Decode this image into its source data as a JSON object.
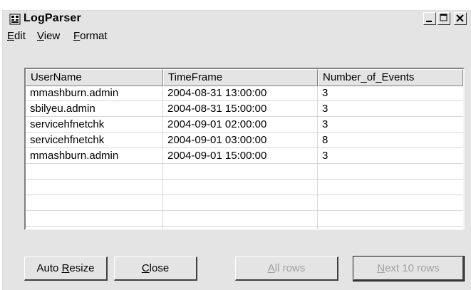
{
  "window": {
    "title": "LogParser",
    "app_icon": "logparser-app-icon",
    "controls": [
      "minimize-icon",
      "maximize-icon",
      "close-icon"
    ]
  },
  "menu": {
    "items": [
      {
        "label_u": "E",
        "label_rest": "dit"
      },
      {
        "label_u": "V",
        "label_rest": "iew"
      },
      {
        "label_u": "F",
        "label_rest": "ormat"
      }
    ]
  },
  "table": {
    "columns": [
      "UserName",
      "TimeFrame",
      "Number_of_Events"
    ],
    "rows": [
      [
        "mmashburn.admin",
        "2004-08-31 13:00:00",
        "3"
      ],
      [
        "sbilyeu.admin",
        "2004-08-31 15:00:00",
        "3"
      ],
      [
        "servicehfnetchk",
        "2004-09-01 02:00:00",
        "3"
      ],
      [
        "servicehfnetchk",
        "2004-09-01 03:00:00",
        "8"
      ],
      [
        "mmashburn.admin",
        "2004-09-01 15:00:00",
        "3"
      ],
      [
        "",
        "",
        ""
      ],
      [
        "",
        "",
        ""
      ],
      [
        "",
        "",
        ""
      ],
      [
        "",
        "",
        ""
      ]
    ]
  },
  "buttons": {
    "auto_resize": {
      "pre": "Auto ",
      "u": "R",
      "post": "esize"
    },
    "close": {
      "pre": "",
      "u": "C",
      "post": "lose"
    },
    "all_rows": {
      "pre": "",
      "u": "A",
      "post": "ll rows"
    },
    "next_rows": {
      "pre": "",
      "u": "N",
      "post": "ext 10 rows"
    }
  }
}
